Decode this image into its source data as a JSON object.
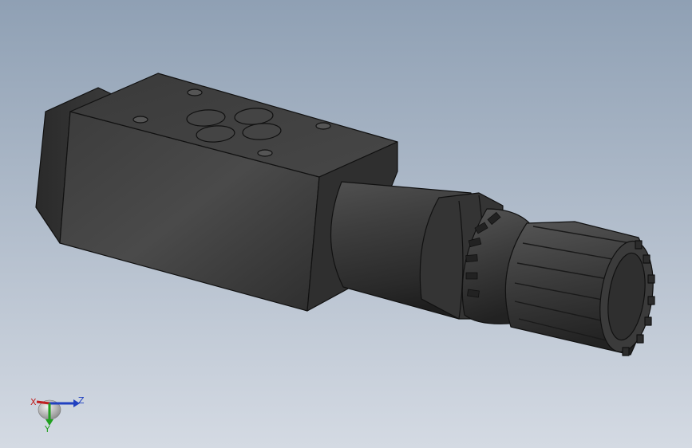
{
  "viewport": {
    "background_top": "#8fa0b4",
    "background_bottom": "#d4dae3",
    "model_color": "#3a3a3a",
    "edge_color": "#111111"
  },
  "triad": {
    "x_label": "X",
    "y_label": "Y",
    "z_label": "Z",
    "x_color": "#c02020",
    "y_color": "#20a020",
    "z_color": "#2040c0"
  }
}
